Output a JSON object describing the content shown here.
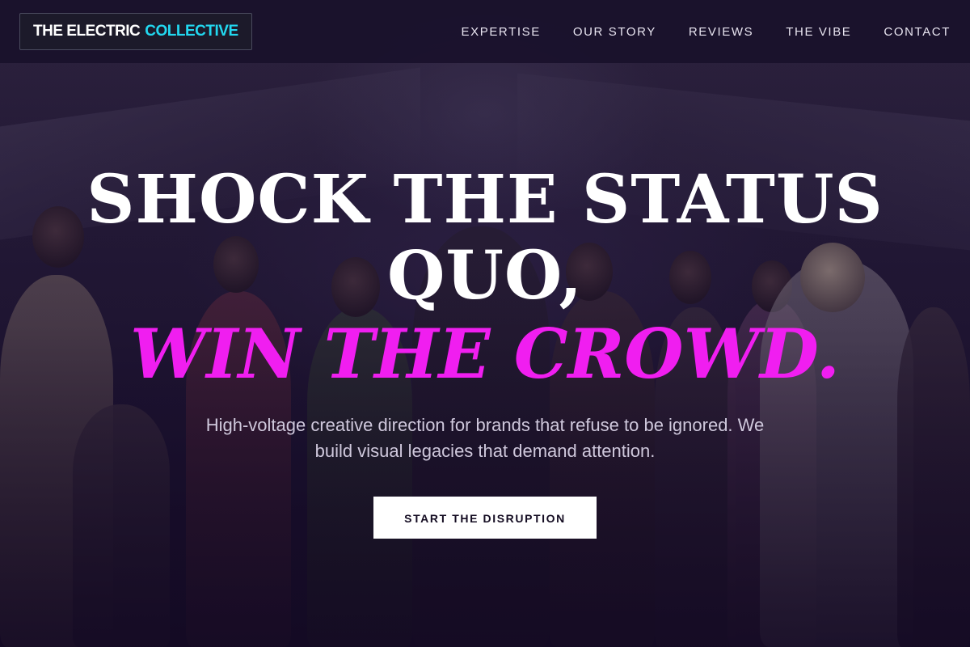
{
  "header": {
    "logo": {
      "part1": "THE ELECTRIC",
      "part2": "COLLECTIVE"
    },
    "nav": [
      {
        "label": "EXPERTISE"
      },
      {
        "label": "OUR STORY"
      },
      {
        "label": "REVIEWS"
      },
      {
        "label": "THE VIBE"
      },
      {
        "label": "CONTACT"
      }
    ]
  },
  "hero": {
    "headline": "SHOCK THE STATUS QUO,",
    "headline_accent": "WIN THE CROWD.",
    "subheadline": "High-voltage creative direction for brands that refuse to be ignored. We build visual legacies that demand attention.",
    "cta_label": "START THE DISRUPTION",
    "background_image": "group-of-people-stage-photo"
  },
  "colors": {
    "accent_cyan": "#22d8f0",
    "accent_magenta": "#f01ef0",
    "background": "#1a1030",
    "cta_background": "#ffffff"
  }
}
